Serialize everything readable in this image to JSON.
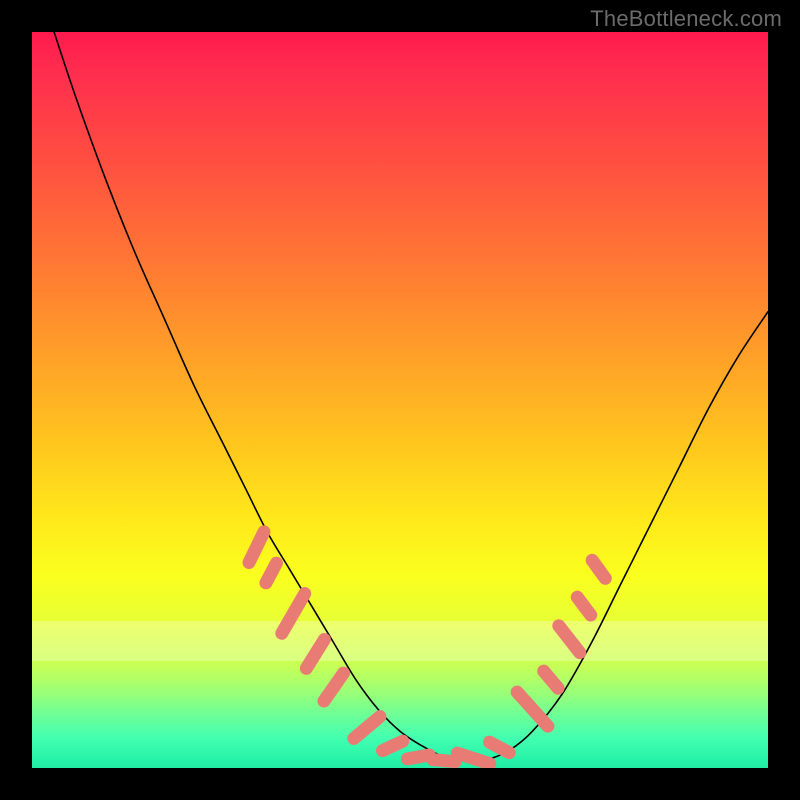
{
  "watermark": "TheBottleneck.com",
  "chart_data": {
    "type": "line",
    "title": "",
    "xlabel": "",
    "ylabel": "",
    "xlim": [
      0,
      100
    ],
    "ylim": [
      0,
      100
    ],
    "series": [
      {
        "name": "curve",
        "x": [
          3,
          6,
          10,
          14,
          18,
          22,
          26,
          29,
          32,
          35,
          38,
          41,
          44,
          47,
          50,
          53,
          56,
          59,
          62,
          65,
          68,
          72,
          76,
          80,
          84,
          88,
          92,
          96,
          100
        ],
        "y": [
          100,
          91,
          80,
          70,
          61,
          52,
          44,
          38,
          32,
          27,
          22,
          17,
          12,
          8,
          5,
          3,
          1.5,
          1,
          1.2,
          2.5,
          5,
          10,
          17,
          25,
          33,
          41,
          49,
          56,
          62
        ]
      }
    ],
    "markers": [
      {
        "x": 30.5,
        "y": 30,
        "len": 4,
        "angle": -64
      },
      {
        "x": 32.5,
        "y": 26.5,
        "len": 3,
        "angle": -62
      },
      {
        "x": 35.5,
        "y": 21,
        "len": 5,
        "angle": -60
      },
      {
        "x": 38.5,
        "y": 15.5,
        "len": 4,
        "angle": -58
      },
      {
        "x": 41,
        "y": 11,
        "len": 4,
        "angle": -55
      },
      {
        "x": 45.5,
        "y": 5.5,
        "len": 4,
        "angle": -40
      },
      {
        "x": 49,
        "y": 3,
        "len": 3,
        "angle": -25
      },
      {
        "x": 52.5,
        "y": 1.5,
        "len": 3,
        "angle": -10
      },
      {
        "x": 56,
        "y": 1,
        "len": 3,
        "angle": 5
      },
      {
        "x": 60,
        "y": 1.3,
        "len": 4,
        "angle": 18
      },
      {
        "x": 63.5,
        "y": 2.8,
        "len": 3,
        "angle": 28
      },
      {
        "x": 68,
        "y": 8,
        "len": 5,
        "angle": 48
      },
      {
        "x": 70.5,
        "y": 12,
        "len": 3,
        "angle": 50
      },
      {
        "x": 73,
        "y": 17.5,
        "len": 4,
        "angle": 52
      },
      {
        "x": 75,
        "y": 22,
        "len": 3,
        "angle": 53
      },
      {
        "x": 77,
        "y": 27,
        "len": 3,
        "angle": 54
      }
    ],
    "gradient_stops": [
      {
        "pct": 0,
        "color": "#ff1a4d"
      },
      {
        "pct": 18,
        "color": "#ff5040"
      },
      {
        "pct": 44,
        "color": "#ffa028"
      },
      {
        "pct": 66,
        "color": "#ffe81a"
      },
      {
        "pct": 86,
        "color": "#c9ff55"
      },
      {
        "pct": 100,
        "color": "#22e9a1"
      }
    ],
    "pale_band": {
      "bottom_pct": 14.5,
      "height_pct": 5.5
    }
  }
}
